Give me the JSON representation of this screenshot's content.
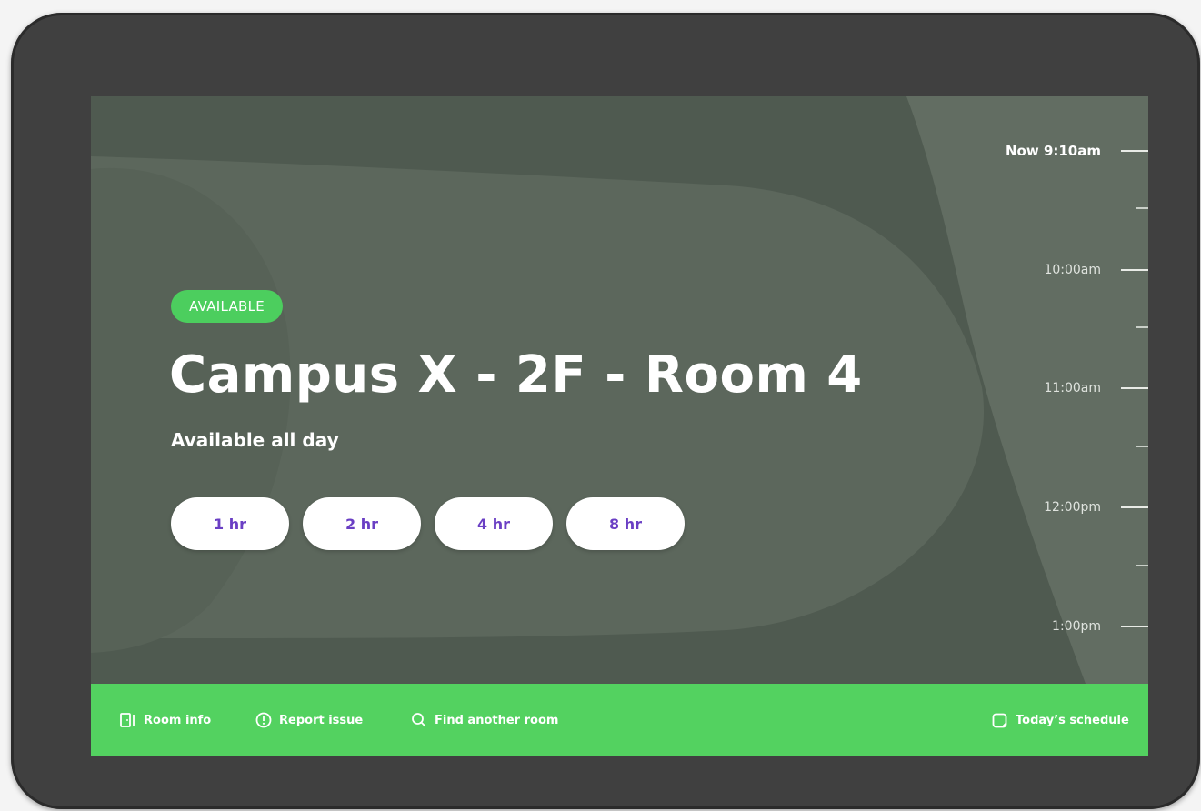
{
  "room": {
    "status": "AVAILABLE",
    "name": "Campus X - 2F - Room 4",
    "availability": "Available all day"
  },
  "booking_options": [
    "1 hr",
    "2 hr",
    "4 hr",
    "8 hr"
  ],
  "timeline": {
    "now": "Now 9:10am",
    "hours": [
      "10:00am",
      "11:00am",
      "12:00pm",
      "1:00pm"
    ]
  },
  "bottom_bar": {
    "room_info": "Room info",
    "report_issue": "Report issue",
    "find_room": "Find another room",
    "schedule": "Today’s schedule"
  },
  "icons": {
    "room_info": "door-icon",
    "report_issue": "alert-circle-icon",
    "find_room": "search-icon",
    "schedule": "calendar-icon"
  },
  "colors": {
    "status_green": "#4cce5e",
    "bar_green": "#53d260",
    "button_text": "#6a3fc4",
    "screen_bg": "#4f5a50",
    "device": "#404040"
  }
}
